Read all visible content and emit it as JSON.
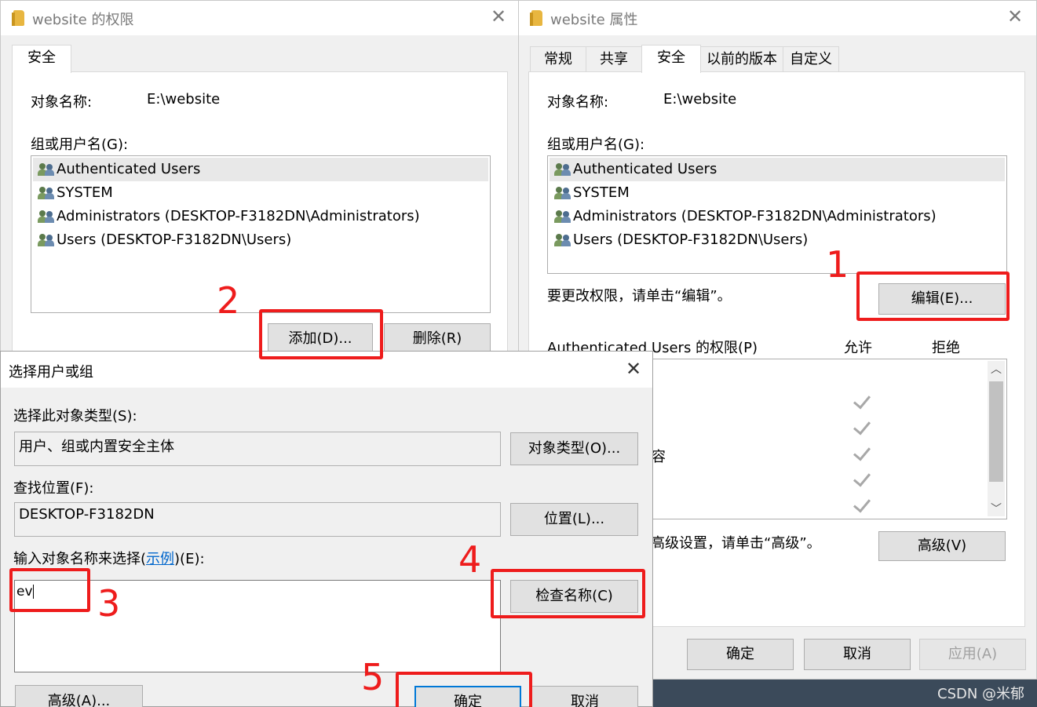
{
  "left_window": {
    "title": "website 的权限",
    "tab": "安全",
    "object_name_label": "对象名称:",
    "object_name_value": "E:\\website",
    "group_label": "组或用户名(G):",
    "users": [
      "Authenticated Users",
      "SYSTEM",
      "Administrators (DESKTOP-F3182DN\\Administrators)",
      "Users (DESKTOP-F3182DN\\Users)"
    ],
    "add_button": "添加(D)...",
    "remove_button": "删除(R)"
  },
  "right_window": {
    "title": "website 属性",
    "tabs": [
      "常规",
      "共享",
      "安全",
      "以前的版本",
      "自定义"
    ],
    "object_name_label": "对象名称:",
    "object_name_value": "E:\\website",
    "group_label": "组或用户名(G):",
    "users": [
      "Authenticated Users",
      "SYSTEM",
      "Administrators (DESKTOP-F3182DN\\Administrators)",
      "Users (DESKTOP-F3182DN\\Users)"
    ],
    "edit_hint": "要更改权限，请单击“编辑”。",
    "edit_button": "编辑(E)...",
    "perm_label": "Authenticated Users 的权限(P)",
    "allow_header": "允许",
    "deny_header": "拒绝",
    "partial_perm_text": "容",
    "advanced_hint_partial": "高级设置，请单击“高级”。",
    "advanced_button": "高级(V)",
    "ok_button": "确定",
    "cancel_button": "取消",
    "apply_button": "应用(A)"
  },
  "select_dialog": {
    "title": "选择用户或组",
    "object_type_label": "选择此对象类型(S):",
    "object_type_value": "用户、组或内置安全主体",
    "object_type_button": "对象类型(O)...",
    "location_label": "查找位置(F):",
    "location_value": "DESKTOP-F3182DN",
    "location_button": "位置(L)...",
    "enter_label_pre": "输入对象名称来选择(",
    "enter_label_link": "示例",
    "enter_label_post": ")(E):",
    "enter_value": "ev",
    "check_names_button": "检查名称(C)",
    "advanced_button": "高级(A)...",
    "ok_button": "确定",
    "cancel_button": "取消"
  },
  "annotations": [
    "1",
    "2",
    "3",
    "4",
    "5"
  ],
  "watermark": "CSDN @米郁",
  "colors": {
    "annotation": "#ee1c1c",
    "link": "#0066cc",
    "desktop": "#3b4a5a"
  }
}
